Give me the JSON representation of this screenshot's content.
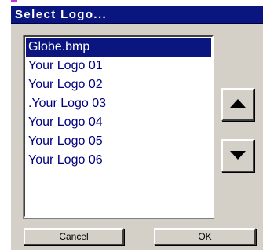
{
  "dialog": {
    "title": "Select Logo...",
    "accent_color": "#0a1580"
  },
  "logo_list": {
    "selected_index": 0,
    "items": [
      "Globe.bmp",
      "Your Logo 01",
      "Your Logo 02",
      ".Your Logo 03",
      "Your Logo 04",
      "Your Logo 05",
      "Your Logo 06"
    ]
  },
  "scroll_buttons": {
    "up_icon": "triangle-up-icon",
    "down_icon": "triangle-down-icon"
  },
  "actions": {
    "cancel_label": "Cancel",
    "ok_label": "OK"
  }
}
